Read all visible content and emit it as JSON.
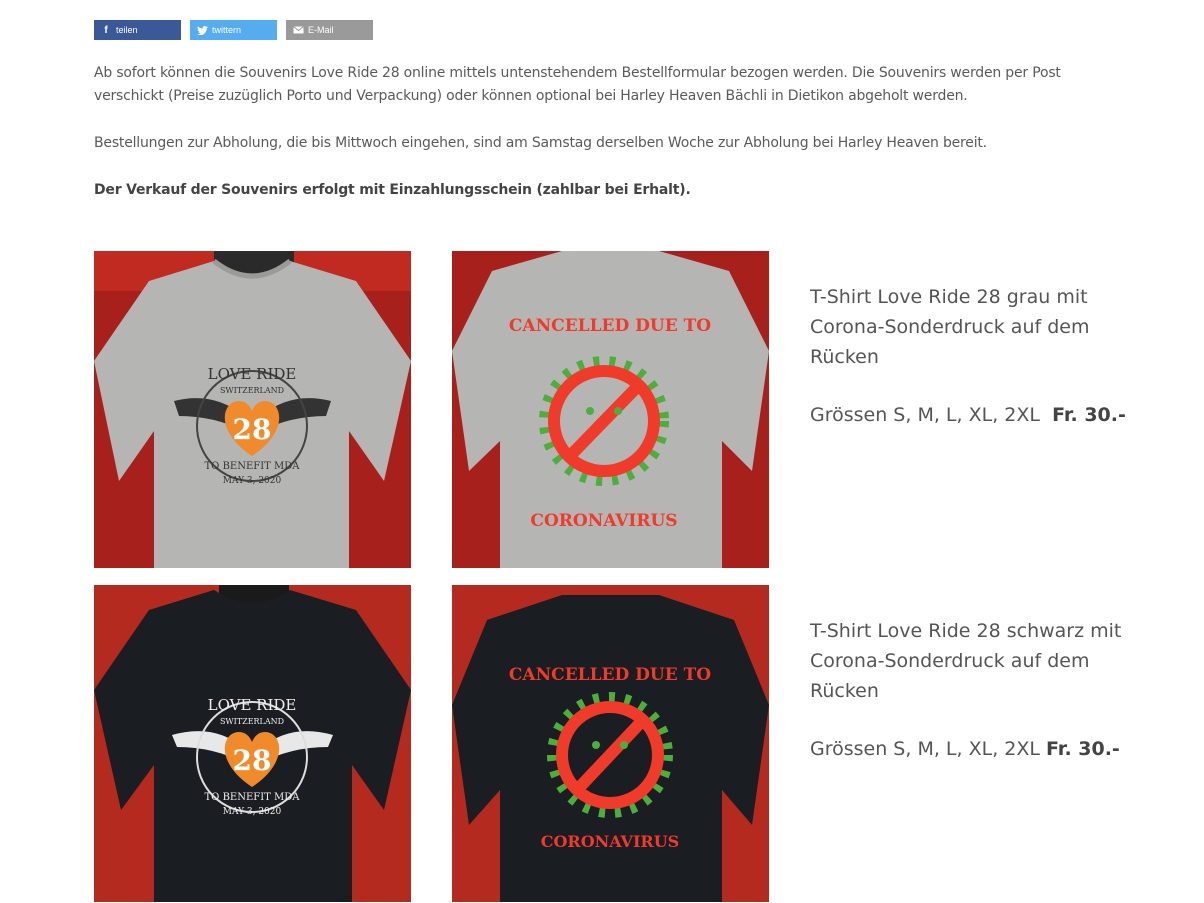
{
  "share": {
    "facebook_label": "teilen",
    "twitter_label": "twittern",
    "email_label": "E-Mail"
  },
  "intro": {
    "p1": "Ab sofort können die Souvenirs Love Ride 28 online mittels untenstehendem Bestellformular bezogen werden. Die Souvenirs werden per Post verschickt (Preise zuzüglich Porto und Verpackung) oder können optional bei Harley Heaven Bächli in Dietikon abgeholt werden.",
    "p2": "Bestellungen zur Abholung, die bis Mittwoch eingehen, sind am Samstag derselben Woche zur Abholung bei Harley Heaven bereit.",
    "p3": "Der Verkauf der Souvenirs erfolgt mit Einzahlungsschein (zahlbar bei Erhalt)."
  },
  "print": {
    "love_ride": "LOVE RIDE",
    "switzerland": "SWITZERLAND",
    "number": "28",
    "benefit": "TO BENEFIT MDA",
    "date": "MAY 3, 2020",
    "cancelled": "CANCELLED DUE TO",
    "coronavirus": "CORONAVIRUS"
  },
  "products": [
    {
      "title": "T-Shirt Love Ride 28 grau mit Corona-Sonderdruck auf dem Rücken",
      "sizes": "Grössen S, M, L, XL, 2XL",
      "price": "Fr. 30.-",
      "shirt_color": "#b5b5b3"
    },
    {
      "title": "T-Shirt Love Ride 28 schwarz mit Corona-Sonderdruck auf dem Rücken",
      "sizes": "Grössen S, M, L, XL, 2XL",
      "price": "Fr. 30.-",
      "shirt_color": "#1a1d22"
    }
  ],
  "colors": {
    "facebook": "#3b5998",
    "twitter": "#55acee",
    "email": "#9a9a9a",
    "background_wall": "#a8201c",
    "print_orange": "#f08a2a",
    "print_red": "#f03a2a",
    "virus_green": "#4caf3c"
  }
}
